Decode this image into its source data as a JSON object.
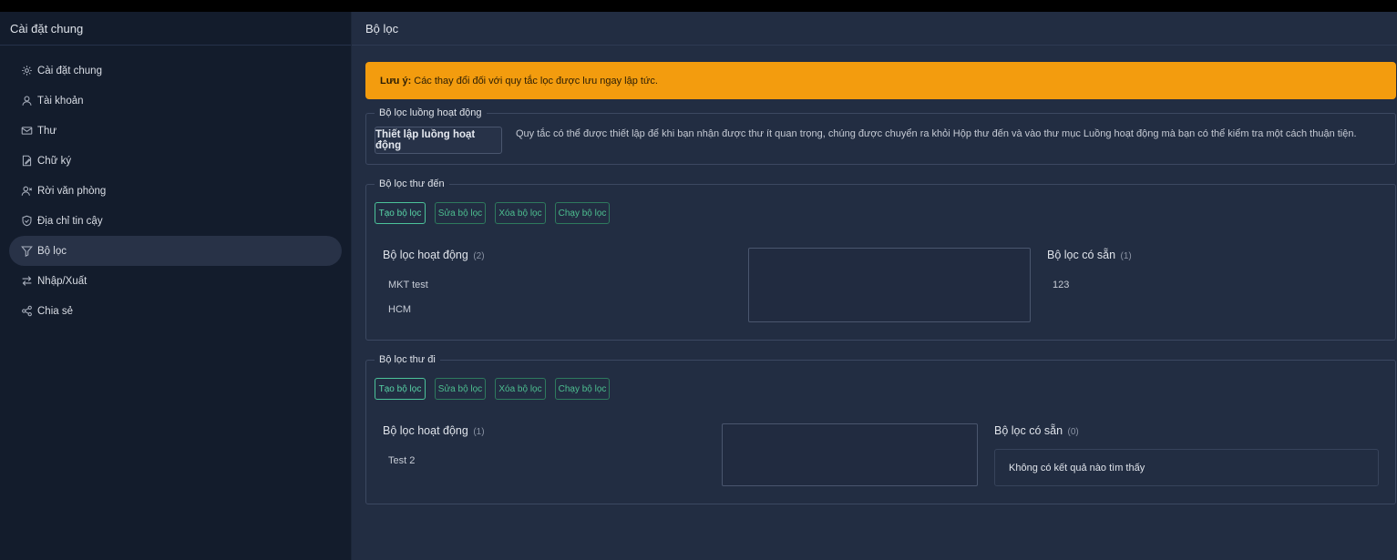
{
  "sidebar": {
    "title": "Cài đặt chung",
    "items": [
      {
        "label": "Cài đặt chung",
        "icon": "gear-icon"
      },
      {
        "label": "Tài khoản",
        "icon": "user-icon"
      },
      {
        "label": "Thư",
        "icon": "mail-icon"
      },
      {
        "label": "Chữ ký",
        "icon": "signature-icon"
      },
      {
        "label": "Rời văn phòng",
        "icon": "user-away-icon"
      },
      {
        "label": "Địa chỉ tin cậy",
        "icon": "shield-icon"
      },
      {
        "label": "Bộ lọc",
        "icon": "filter-icon"
      },
      {
        "label": "Nhập/Xuất",
        "icon": "arrows-icon"
      },
      {
        "label": "Chia sẻ",
        "icon": "share-icon"
      }
    ]
  },
  "main": {
    "title": "Bộ lọc",
    "alert": {
      "label": "Lưu ý:",
      "text": "Các thay đổi đối với quy tắc lọc được lưu ngay lập tức.",
      "color": "#f39c0e"
    },
    "focus": {
      "legend": "Bộ lọc luồng hoạt động",
      "button": "Thiết lập luồng hoạt động",
      "description": "Quy tắc có thể được thiết lập để khi bạn nhận được thư ít quan trọng, chúng được chuyển ra khỏi Hộp thư đến và vào thư mục Luồng hoạt động mà bạn có thể kiểm tra một cách thuận tiện."
    },
    "incoming": {
      "legend": "Bộ lọc thư đến",
      "buttons": {
        "create": "Tạo bộ lọc",
        "edit": "Sửa bộ lọc",
        "delete": "Xóa bộ lọc",
        "run": "Chạy bộ lọc"
      },
      "active_title": "Bộ lọc hoạt động",
      "active_count": "(2)",
      "active_items": [
        "MKT test",
        "HCM"
      ],
      "available_title": "Bộ lọc có sẵn",
      "available_count": "(1)",
      "available_items": [
        "123"
      ]
    },
    "outgoing": {
      "legend": "Bộ lọc thư đi",
      "buttons": {
        "create": "Tạo bộ lọc",
        "edit": "Sửa bộ lọc",
        "delete": "Xóa bộ lọc",
        "run": "Chạy bộ lọc"
      },
      "active_title": "Bộ lọc hoạt động",
      "active_count": "(1)",
      "active_items": [
        "Test 2"
      ],
      "available_title": "Bộ lọc có sẵn",
      "available_count": "(0)",
      "empty_text": "Không có kết quả nào tìm thấy"
    }
  }
}
